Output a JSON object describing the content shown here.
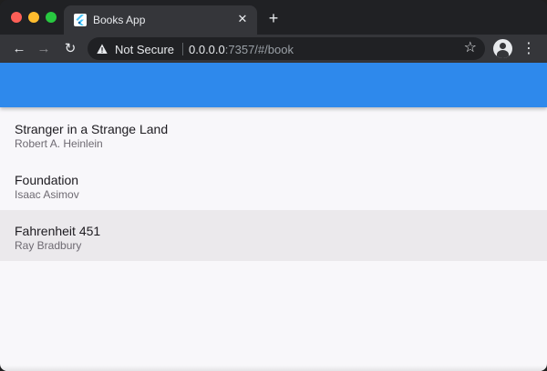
{
  "window": {
    "traffic_lights": [
      "close",
      "minimize",
      "zoom"
    ]
  },
  "tab": {
    "title": "Books App",
    "favicon": "flutter-icon",
    "close_label": "✕",
    "new_tab_label": "+"
  },
  "toolbar": {
    "back_label": "←",
    "forward_label": "→",
    "reload_label": "↻",
    "security_label": "Not Secure",
    "url_host": "0.0.0.0",
    "url_rest": ":7357/#/book",
    "star_label": "☆",
    "menu_label": "⋮"
  },
  "colors": {
    "appbar": "#2e89ec",
    "selected_row": "#ebe9ec",
    "page_background": "#f8f7fa"
  },
  "books": [
    {
      "title": "Stranger in a Strange Land",
      "author": "Robert A. Heinlein",
      "selected": false
    },
    {
      "title": "Foundation",
      "author": "Isaac Asimov",
      "selected": false
    },
    {
      "title": "Fahrenheit 451",
      "author": "Ray Bradbury",
      "selected": true
    }
  ]
}
